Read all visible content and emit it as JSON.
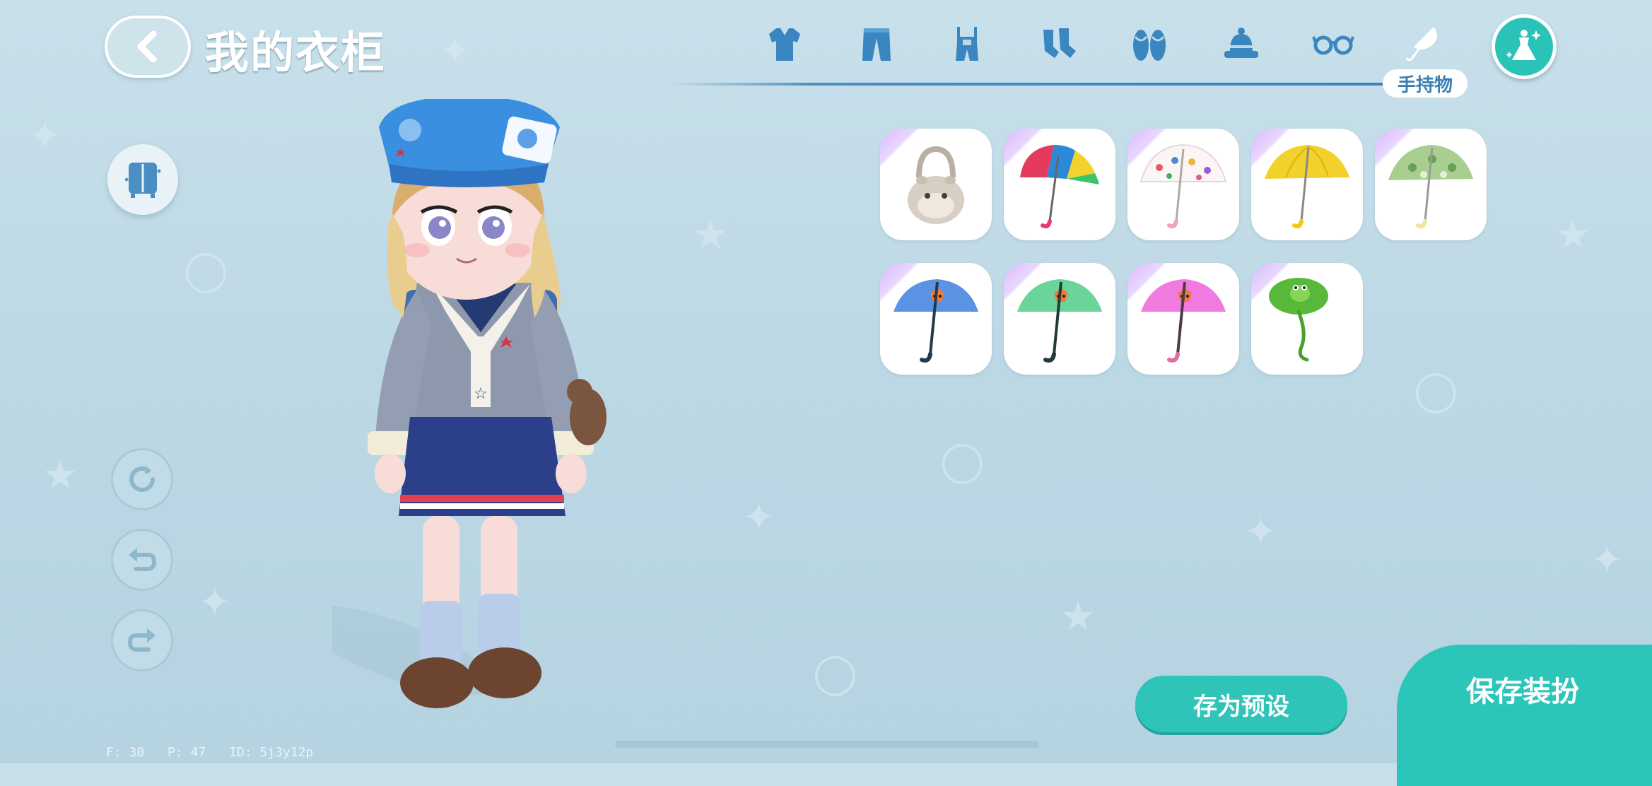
{
  "header": {
    "back_icon": "chevron-left-icon",
    "title": "我的衣柜"
  },
  "tabs": [
    {
      "icon": "shirt-icon"
    },
    {
      "icon": "pants-icon"
    },
    {
      "icon": "overalls-icon"
    },
    {
      "icon": "socks-icon"
    },
    {
      "icon": "slippers-icon"
    },
    {
      "icon": "hat-icon"
    },
    {
      "icon": "glasses-icon"
    },
    {
      "icon": "umbrella-icon",
      "selected": true,
      "label": "手持物"
    }
  ],
  "selected_tab_label": "手持物",
  "items": [
    {
      "icon": "hamster-basket-icon"
    },
    {
      "icon": "rainbow-umbrella-icon"
    },
    {
      "icon": "polka-dot-umbrella-icon"
    },
    {
      "icon": "yellow-umbrella-icon"
    },
    {
      "icon": "green-pattern-umbrella-icon"
    },
    {
      "icon": "blue-fox-umbrella-icon"
    },
    {
      "icon": "green-fox-umbrella-icon"
    },
    {
      "icon": "pink-fox-umbrella-icon"
    },
    {
      "icon": "frog-leaf-umbrella-icon"
    }
  ],
  "buttons": {
    "save_preset": "存为预设",
    "save_outfit": "保存装扮"
  },
  "debug": {
    "fps": "F: 30",
    "ping": "P: 47",
    "id": "ID: 5j3y12p"
  },
  "colors": {
    "accent_teal": "#2cc5b9",
    "tab_blue": "#3a82b8"
  }
}
